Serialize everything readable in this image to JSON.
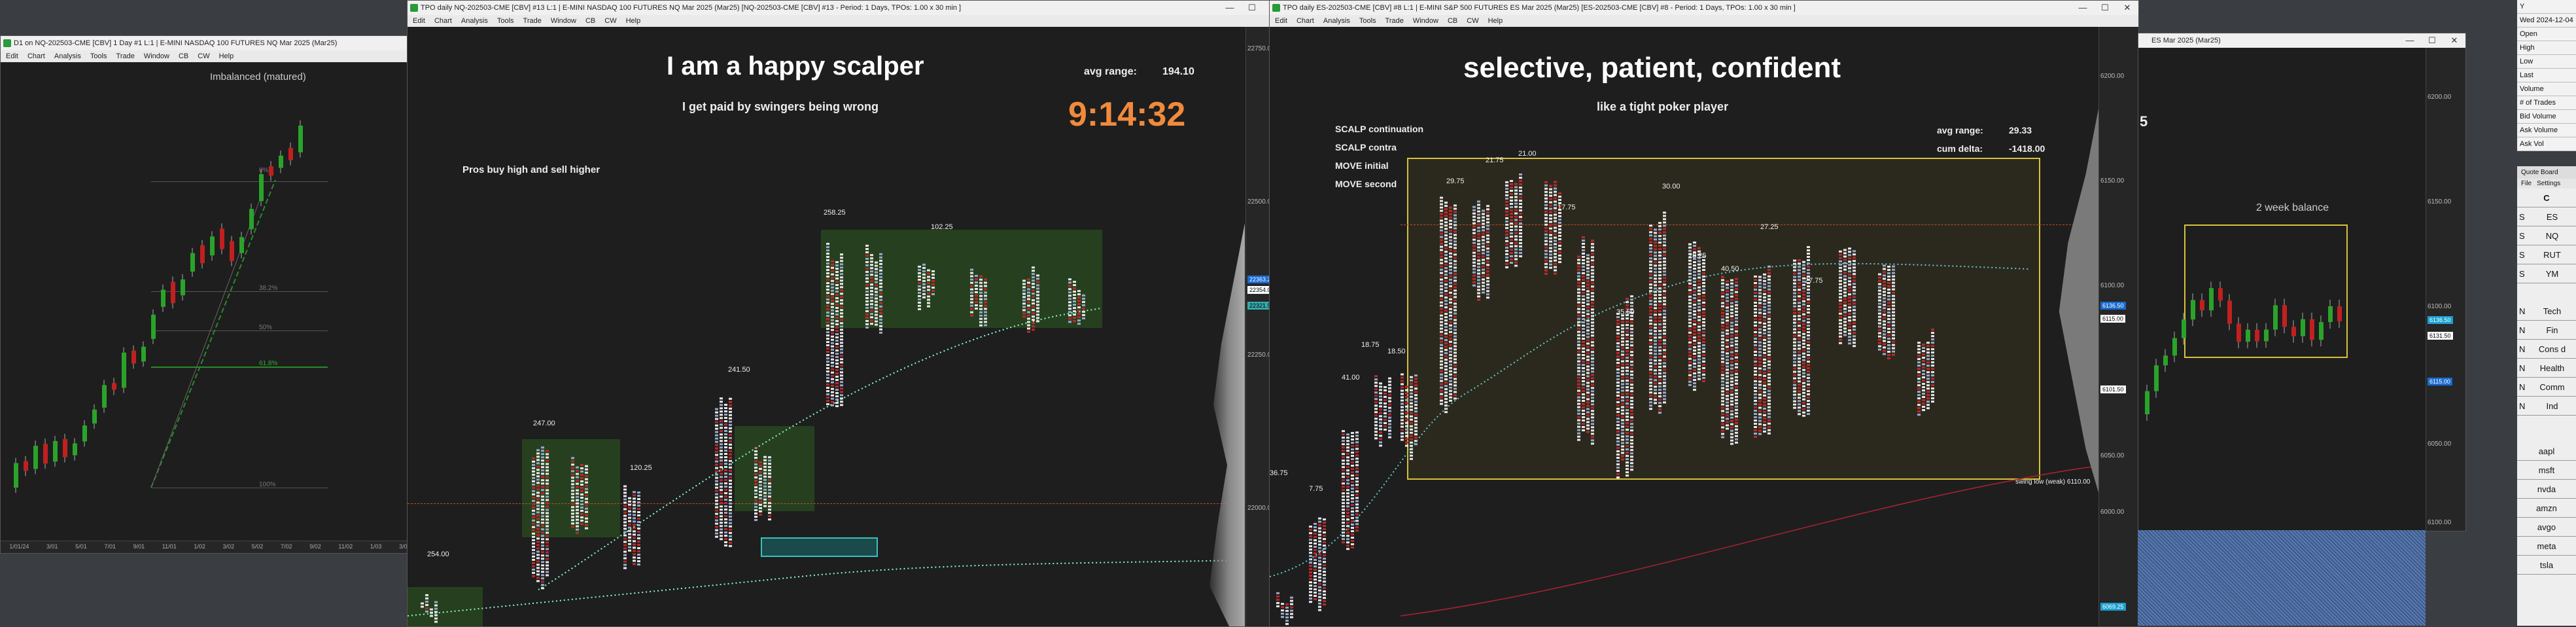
{
  "win1": {
    "title": "D1 on NQ-202503-CME [CBV] 1 Day #1 L:1 | E-MINI NASDAQ 100 FUTURES NQ Mar 2025 (Mar25)",
    "menu": [
      "Edit",
      "Chart",
      "Analysis",
      "Tools",
      "Trade",
      "Window",
      "CB",
      "CW",
      "Help"
    ],
    "annotation": "Imbalanced (matured)",
    "fib_labels": [
      "0%",
      "38.2%",
      "50%",
      "61.8%",
      "100%"
    ],
    "dates": [
      "1/01/24",
      "3/01",
      "5/01",
      "7/01",
      "9/01",
      "11/01",
      "1/02",
      "3/02",
      "5/02",
      "7/02",
      "9/02",
      "11/02",
      "1/03",
      "3/03"
    ]
  },
  "win2": {
    "title": "TPO daily NQ-202503-CME [CBV] #13 L:1 | E-MINI NASDAQ 100 FUTURES NQ Mar 2025 (Mar25) [NQ-202503-CME [CBV] #13 - Period: 1 Days, TPOs: 1.00 x 30 min ]",
    "menu": [
      "Edit",
      "Chart",
      "Analysis",
      "Tools",
      "Trade",
      "Window",
      "CB",
      "CW",
      "Help"
    ],
    "headline": "I am a happy scalper",
    "subline": "I get paid by swingers being wrong",
    "note": "Pros buy high and sell higher",
    "avg_range_label": "avg range:",
    "avg_range_value": "194.10",
    "clock": "9:14:32",
    "range_labels": [
      "254.00",
      "247.00",
      "120.25",
      "241.50",
      "258.25",
      "102.25"
    ],
    "y_labels": [
      "22750.00",
      "22500.00",
      "22250.00",
      "22000.00"
    ],
    "price_tags": [
      "22363.25",
      "22354.00",
      "22321.50"
    ]
  },
  "win3": {
    "title": "TPO daily ES-202503-CME [CBV] #8 L:1 | E-MINI S&P 500 FUTURES ES Mar 2025 (Mar25) [ES-202503-CME [CBV] #8 - Period: 1 Days, TPOs: 1.00 x 30 min ]",
    "menu": [
      "Edit",
      "Chart",
      "Analysis",
      "Tools",
      "Trade",
      "Window",
      "CB",
      "CW",
      "Help"
    ],
    "headline": "selective,  patient,  confident",
    "subline": "like a tight poker player",
    "left_notes": [
      "SCALP continuation",
      "SCALP contra",
      "MOVE initial",
      "MOVE second"
    ],
    "avg_range_label": "avg range:",
    "avg_range_value": "29.33",
    "cum_delta_label": "cum delta:",
    "cum_delta_value": "-1418.00",
    "range_labels": [
      "36.75",
      "7.75",
      "41.00",
      "18.75",
      "18.50",
      "29.75",
      "21.75",
      "21.00",
      "17.75",
      "35.50",
      "30.00",
      "28.25",
      "40.50",
      "27.25",
      "27.75"
    ],
    "swing_low": "swing low (weak)  6110.00",
    "y_labels": [
      "6200.00",
      "6150.00",
      "6100.00",
      "6050.00",
      "6000.00"
    ],
    "price_tags": [
      "6136.50",
      "6115.00",
      "6101.50",
      "6069.25"
    ]
  },
  "win4": {
    "title": "ES Mar 2025 (Mar25)",
    "number": "5",
    "annotation": "2 week balance",
    "y_labels": [
      "6200.00",
      "6150.00",
      "6100.00",
      "6050.00",
      "6100.00"
    ],
    "price_tags": [
      "6136.50",
      "6131.50",
      "6115.00"
    ]
  },
  "data_panel": {
    "rows": [
      "Y",
      "Wed 2024-12-04",
      "Open",
      "High",
      "Low",
      "Last",
      "Volume",
      "# of Trades",
      "Bid Volume",
      "Ask Volume",
      "Ask Vol"
    ]
  },
  "quote_board": {
    "title": "Quote Board",
    "menu": [
      "File",
      "Settings"
    ],
    "col_header": "C",
    "futures": [
      "ES",
      "NQ",
      "RUT",
      "YM"
    ],
    "sectors": [
      "Tech",
      "Fin",
      "Cons d",
      "Health",
      "Comm",
      "Ind"
    ],
    "stocks": [
      "aapl",
      "msft",
      "nvda",
      "amzn",
      "avgo",
      "meta",
      "tsla"
    ]
  },
  "colors": {
    "bull": "#2aa32a",
    "bear": "#c0201f",
    "clock": "#f08a3c",
    "box_green": "#26401f",
    "box_yellow": "#d6c23a"
  }
}
